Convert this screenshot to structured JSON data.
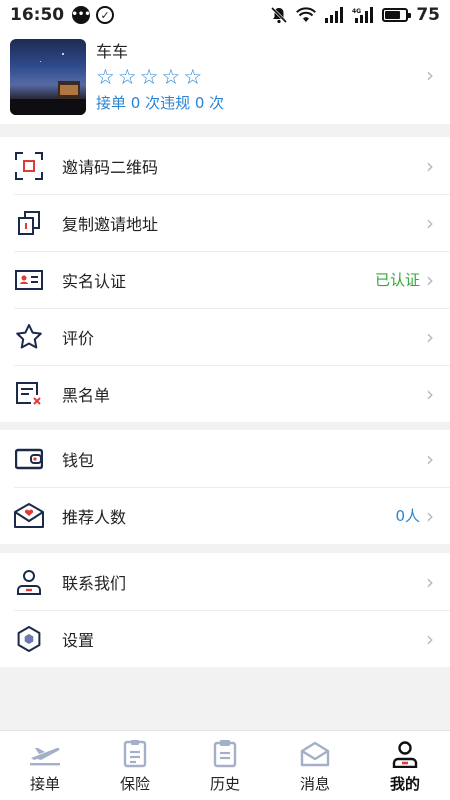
{
  "status_bar": {
    "time": "16:50",
    "battery": "75"
  },
  "profile": {
    "name": "车车",
    "stars": [
      "☆",
      "☆",
      "☆",
      "☆",
      "☆"
    ],
    "stats": "接单 0 次违规 0 次"
  },
  "menu": {
    "qrcode": "邀请码二维码",
    "copy_link": "复制邀请地址",
    "realname": "实名认证",
    "realname_status": "已认证",
    "review": "评价",
    "blacklist": "黑名单",
    "wallet": "钱包",
    "referrals": "推荐人数",
    "referrals_count": "0人",
    "contact": "联系我们",
    "settings": "设置"
  },
  "tabbar": {
    "tabs": [
      {
        "label": "接单",
        "icon": "plane-icon"
      },
      {
        "label": "保险",
        "icon": "document-icon"
      },
      {
        "label": "历史",
        "icon": "clipboard-icon"
      },
      {
        "label": "消息",
        "icon": "envelope-icon"
      },
      {
        "label": "我的",
        "icon": "person-icon"
      }
    ],
    "active_index": 4
  },
  "colors": {
    "accent": "#2a84d2",
    "verified": "#34a83a",
    "icon_navy": "#1c2a4a",
    "icon_red": "#e03a3a"
  }
}
